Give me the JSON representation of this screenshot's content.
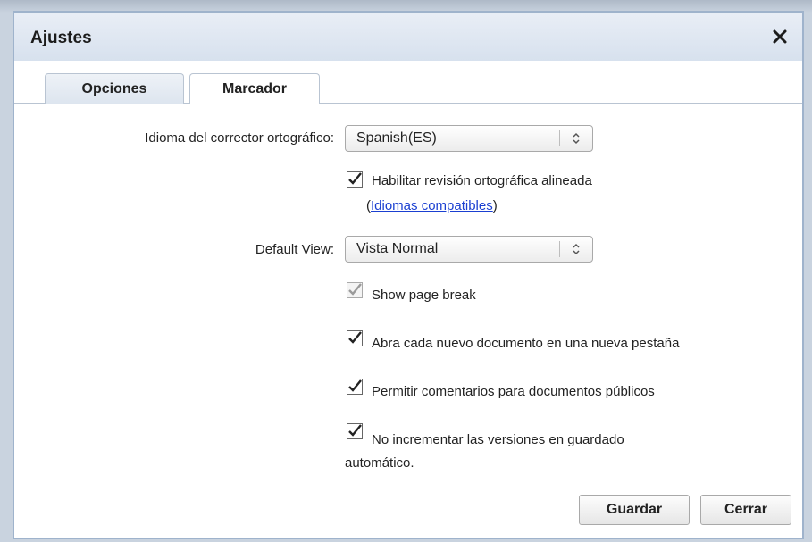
{
  "dialog": {
    "title": "Ajustes"
  },
  "tabs": [
    {
      "label": "Opciones",
      "active": true
    },
    {
      "label": "Marcador",
      "active": false
    }
  ],
  "spell_language": {
    "label": "Idioma del corrector ortográfico:",
    "value": "Spanish(ES)"
  },
  "inline_spellcheck": {
    "label": "Habilitar revisión ortográfica alineada",
    "checked": true,
    "link_prefix": "(",
    "link_text": "Idiomas compatibles",
    "link_suffix": ")"
  },
  "default_view": {
    "label": "Default View:",
    "value": "Vista Normal"
  },
  "options": [
    {
      "label": "Show page break",
      "checked": true,
      "disabled": true
    },
    {
      "label": "Abra cada nuevo documento en una nueva pestaña",
      "checked": true,
      "disabled": false
    },
    {
      "label": "Permitir comentarios para documentos públicos",
      "checked": true,
      "disabled": false
    },
    {
      "label": "No incrementar las versiones en guardado",
      "label_cont": "automático.",
      "checked": true,
      "disabled": false
    }
  ],
  "buttons": {
    "save": "Guardar",
    "close": "Cerrar"
  },
  "colors": {
    "titlebar": "#dde5ef",
    "border": "#9fb3cc",
    "link": "#1a3fd1"
  }
}
